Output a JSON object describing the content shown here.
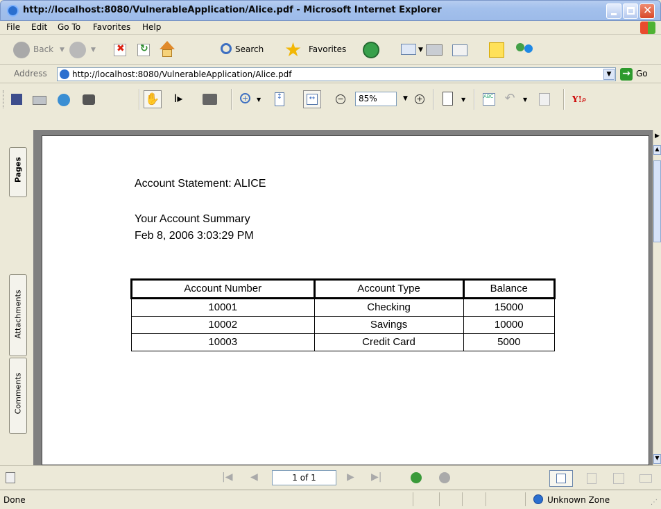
{
  "window": {
    "title": "http://localhost:8080/VulnerableApplication/Alice.pdf - Microsoft Internet Explorer"
  },
  "menu": [
    "File",
    "Edit",
    "Go To",
    "Favorites",
    "Help"
  ],
  "toolbar": {
    "back_label": "Back",
    "search_label": "Search",
    "favorites_label": "Favorites"
  },
  "address": {
    "label": "Address",
    "url": "http://localhost:8080/VulnerableApplication/Alice.pdf",
    "go_label": "Go"
  },
  "pdf_toolbar": {
    "zoom": "85%"
  },
  "sidebar": {
    "pages_tab": "Pages",
    "attachments_tab": "Attachments",
    "comments_tab": "Comments"
  },
  "document": {
    "heading": "Account Statement: ALICE",
    "summary_title": "Your Account Summary",
    "timestamp": "Feb 8, 2006 3:03:29 PM",
    "table": {
      "headers": [
        "Account Number",
        "Account Type",
        "Balance"
      ],
      "rows": [
        [
          "10001",
          "Checking",
          "15000"
        ],
        [
          "10002",
          "Savings",
          "10000"
        ],
        [
          "10003",
          "Credit Card",
          "5000"
        ]
      ]
    }
  },
  "nav": {
    "page_indicator": "1 of 1"
  },
  "status": {
    "left": "Done",
    "zone": "Unknown Zone"
  },
  "colors": {
    "titlebar": "#a3c0ec",
    "chrome": "#ece9d8",
    "doc_background": "#808080",
    "close_button": "#d8482a"
  }
}
